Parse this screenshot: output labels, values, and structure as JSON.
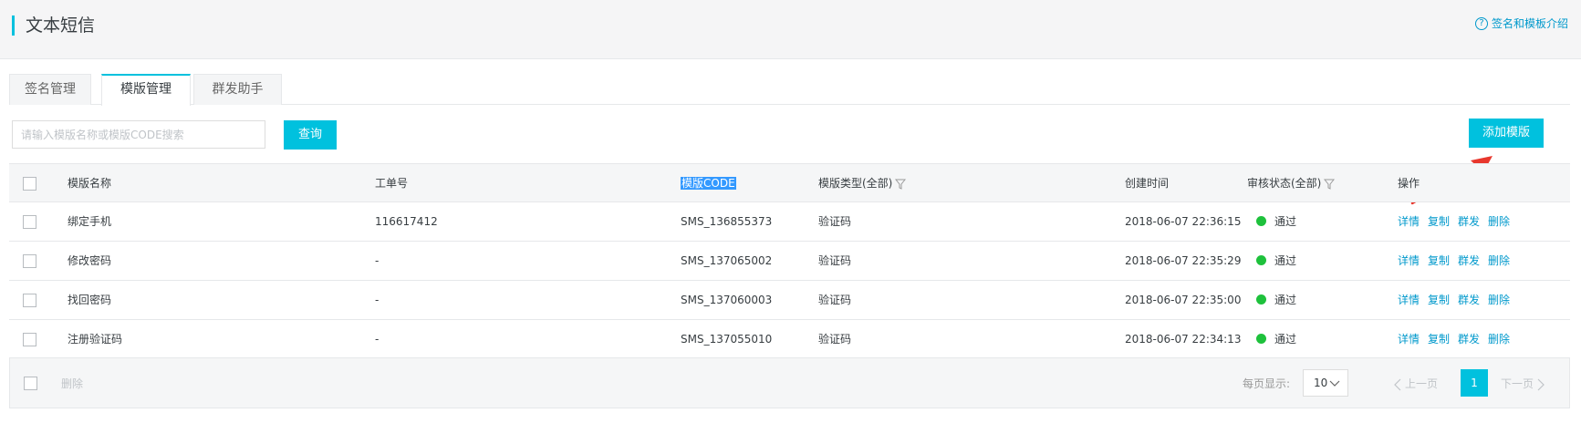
{
  "header": {
    "title": "文本短信",
    "help_icon": "?",
    "help_link": "签名和模板介绍"
  },
  "tabs": [
    {
      "label": "签名管理",
      "active": false
    },
    {
      "label": "模版管理",
      "active": true
    },
    {
      "label": "群发助手",
      "active": false
    }
  ],
  "search": {
    "placeholder": "请输入模版名称或模版CODE搜索",
    "value": "",
    "button": "查询"
  },
  "add_button": "添加模版",
  "colors": {
    "accent": "#00c1de",
    "link": "#0099cc",
    "status_pass": "#1ec13c",
    "annotation_arrow": "#e8372d"
  },
  "table": {
    "headers": {
      "name": "模版名称",
      "ticket": "工单号",
      "code": "模版CODE",
      "type": "模版类型(全部)",
      "created": "创建时间",
      "status": "审核状态(全部)",
      "actions": "操作"
    },
    "rows": [
      {
        "name": "绑定手机",
        "ticket": "116617412",
        "code": "SMS_136855373",
        "type": "验证码",
        "created": "2018-06-07 22:36:15",
        "status": "通过"
      },
      {
        "name": "修改密码",
        "ticket": "-",
        "code": "SMS_137065002",
        "type": "验证码",
        "created": "2018-06-07 22:35:29",
        "status": "通过"
      },
      {
        "name": "找回密码",
        "ticket": "-",
        "code": "SMS_137060003",
        "type": "验证码",
        "created": "2018-06-07 22:35:00",
        "status": "通过"
      },
      {
        "name": "注册验证码",
        "ticket": "-",
        "code": "SMS_137055010",
        "type": "验证码",
        "created": "2018-06-07 22:34:13",
        "status": "通过"
      }
    ],
    "actions": [
      "详情",
      "复制",
      "群发",
      "删除"
    ]
  },
  "footer": {
    "delete_label": "删除",
    "per_page_label": "每页显示:",
    "per_page_value": "10",
    "prev": "上一页",
    "current_page": "1",
    "next": "下一页"
  }
}
